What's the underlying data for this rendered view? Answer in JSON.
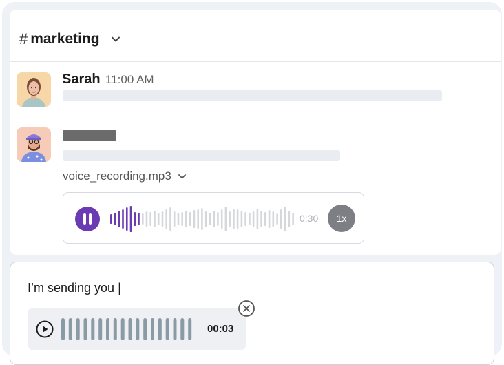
{
  "channel": {
    "hash": "#",
    "name": "marketing"
  },
  "messages": [
    {
      "author": "Sarah",
      "time": "11:00 AM",
      "avatar": "avatar-woman"
    },
    {
      "author": "",
      "avatar": "avatar-man-cap",
      "attachment": {
        "filename": "voice_recording.mp3",
        "duration": "0:30",
        "speed": "1x",
        "played_fraction": 0.17,
        "state": "playing"
      }
    }
  ],
  "composer": {
    "text": "I’m sending you |",
    "recording": {
      "duration": "00:03"
    }
  },
  "colors": {
    "accent": "#6a3bb3",
    "wave_unplayed": "#d5d7db",
    "wave_recording": "#8a9ba6"
  },
  "icons": [
    "chevron-down-icon",
    "pause-icon",
    "play-icon",
    "close-circle-icon"
  ]
}
